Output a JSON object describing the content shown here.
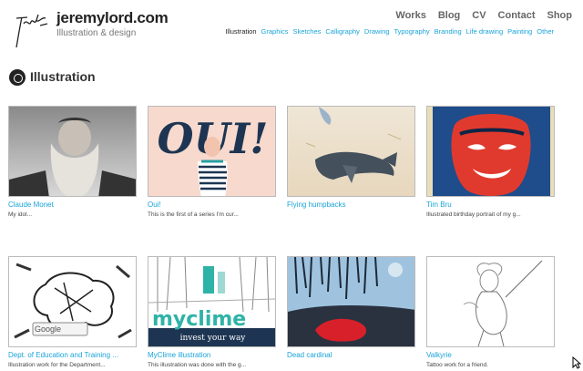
{
  "header": {
    "site_title": "jeremylord.com",
    "tagline": "Illustration & design",
    "main_nav": [
      "Works",
      "Blog",
      "CV",
      "Contact",
      "Shop"
    ],
    "sub_nav": [
      "Illustration",
      "Graphics",
      "Sketches",
      "Calligraphy",
      "Drawing",
      "Typography",
      "Branding",
      "Life drawing",
      "Painting",
      "Other"
    ],
    "sub_nav_active": "Illustration"
  },
  "section": {
    "title": "Illustration"
  },
  "items": [
    {
      "title": "Claude Monet",
      "desc": "My idol..."
    },
    {
      "title": "Oui!",
      "desc": "This is the first of a series I'm cur...",
      "thumb_text": "OUI!"
    },
    {
      "title": "Flying humpbacks",
      "desc": ""
    },
    {
      "title": "Tim Bru",
      "desc": "Illustrated birthday portrait of my g..."
    },
    {
      "title": "Dept. of Education and Training ...",
      "desc": "Illustration work for the Department...",
      "thumb_text": "Google"
    },
    {
      "title": "MyClime illustration",
      "desc": "This illustration was done with the g...",
      "thumb_text": "myclime",
      "thumb_subtext": "invest your way"
    },
    {
      "title": "Dead cardinal",
      "desc": ""
    },
    {
      "title": "Valkyrie",
      "desc": "Tattoo work for a friend."
    }
  ],
  "colors": {
    "link": "#1aa4d8",
    "nav": "#666666",
    "heading": "#333333"
  }
}
